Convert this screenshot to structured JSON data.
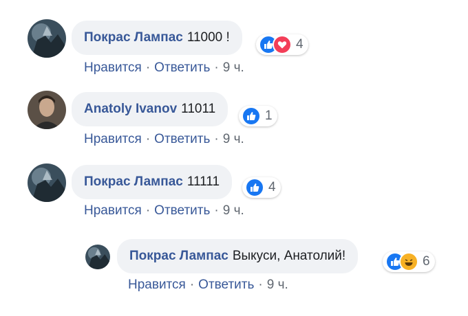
{
  "colors": {
    "author": "#385898",
    "like": "#1877f2",
    "love": "#f33e58",
    "haha": "#f7b125",
    "bubble": "#f0f2f5"
  },
  "comments": [
    {
      "author": "Покрас Лампас",
      "text": "11000 !",
      "reaction_count": "4",
      "reactions": [
        "like-icon",
        "love-icon"
      ],
      "like_label": "Нравится",
      "reply_label": "Ответить",
      "time": "9 ч."
    },
    {
      "author": "Anatoly Ivanov",
      "text": "11011",
      "reaction_count": "1",
      "reactions": [
        "like-icon"
      ],
      "like_label": "Нравится",
      "reply_label": "Ответить",
      "time": "9 ч."
    },
    {
      "author": "Покрас Лампас",
      "text": "11111",
      "reaction_count": "4",
      "reactions": [
        "like-icon"
      ],
      "like_label": "Нравится",
      "reply_label": "Ответить",
      "time": "9 ч."
    },
    {
      "author": "Покрас Лампас",
      "text": "Выкуси, Анатолий!",
      "reaction_count": "6",
      "reactions": [
        "like-icon",
        "haha-icon"
      ],
      "like_label": "Нравится",
      "reply_label": "Ответить",
      "time": "9 ч."
    }
  ],
  "separator": "·"
}
